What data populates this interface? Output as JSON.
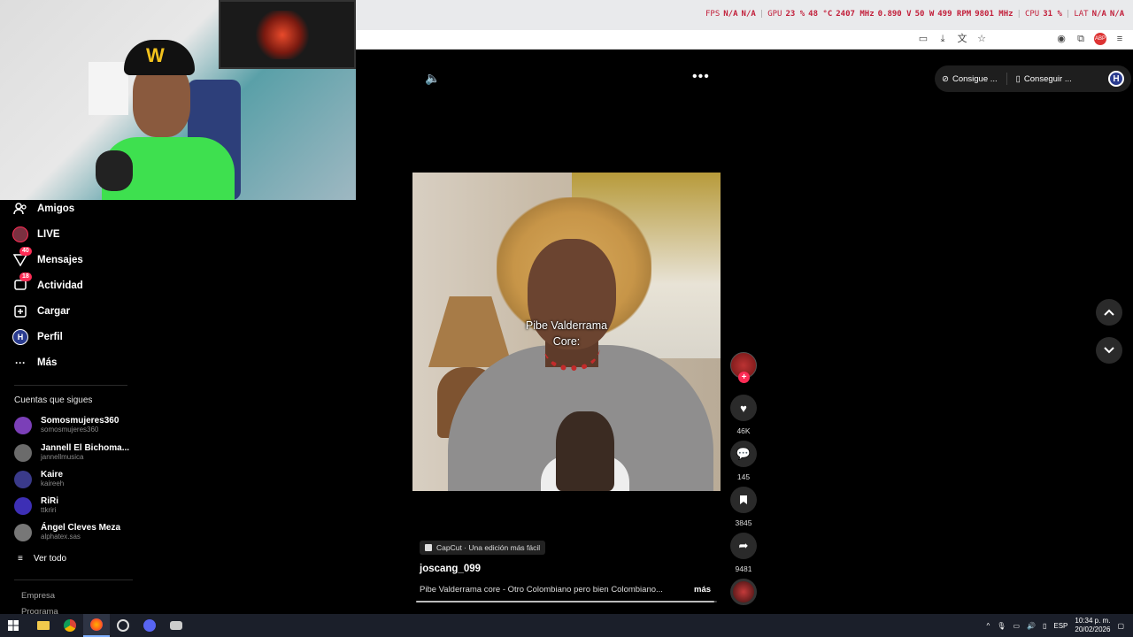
{
  "overlay": {
    "fps_label": "FPS",
    "fps_value": "N/A",
    "fps_value2": "N/A",
    "gpu_label": "GPU",
    "gpu_load": "23 %",
    "gpu_temp": "48 °C",
    "gpu_clock": "2407 MHz",
    "gpu_volt": "0.890 V",
    "gpu_power": "50 W",
    "gpu_fan": "499 RPM",
    "gpu_mem": "9801 MHz",
    "cpu_label": "CPU",
    "cpu_load": "31 %",
    "lat_label": "LAT",
    "lat_value": "N/A",
    "lat_value2": "N/A",
    "color": "#c21f3a"
  },
  "sidebar": {
    "items": [
      {
        "label": "Amigos",
        "icon": "friends-icon"
      },
      {
        "label": "LIVE",
        "icon": "live-icon"
      },
      {
        "label": "Mensajes",
        "icon": "messages-icon",
        "badge": "40"
      },
      {
        "label": "Actividad",
        "icon": "activity-icon",
        "badge": "18"
      },
      {
        "label": "Cargar",
        "icon": "upload-icon"
      },
      {
        "label": "Perfil",
        "icon": "profile-icon"
      },
      {
        "label": "Más",
        "icon": "more-icon"
      }
    ],
    "following_title": "Cuentas que sigues",
    "following": [
      {
        "name": "Somosmujeres360",
        "handle": "somosmujeres360",
        "color": "#7b3fb8"
      },
      {
        "name": "Jannell El Bichoma...",
        "handle": "jannellmusica",
        "color": "#6b6b6b"
      },
      {
        "name": "Kaire",
        "handle": "kaireeh",
        "color": "#3a3a8a"
      },
      {
        "name": "RiRi",
        "handle": "ttkriri",
        "color": "#3d2fb5"
      },
      {
        "name": "Ángel Cleves Meza",
        "handle": "alphatex.sas",
        "color": "#777"
      }
    ],
    "see_all": "Ver todo",
    "footer": [
      "Empresa",
      "Programa"
    ]
  },
  "top": {
    "pill_item_1": "Consigue ...",
    "pill_item_2": "Conseguir ...",
    "profile_initial": "H"
  },
  "video": {
    "caption_line1": "Pibe Valderrama",
    "caption_line2": "Core:",
    "capcut_label": "CapCut · Una edición más fácil",
    "username": "joscang_099",
    "description": "Pibe Valderrama core - Otro Colombiano pero bien Colombiano...",
    "more": "más",
    "progress": 0.99
  },
  "actions": {
    "likes": "46K",
    "comments": "145",
    "saves": "3845",
    "shares": "9481"
  },
  "taskbar": {
    "language": "ESP",
    "time": "10:34 p. m.",
    "date": "20/02/2026"
  }
}
